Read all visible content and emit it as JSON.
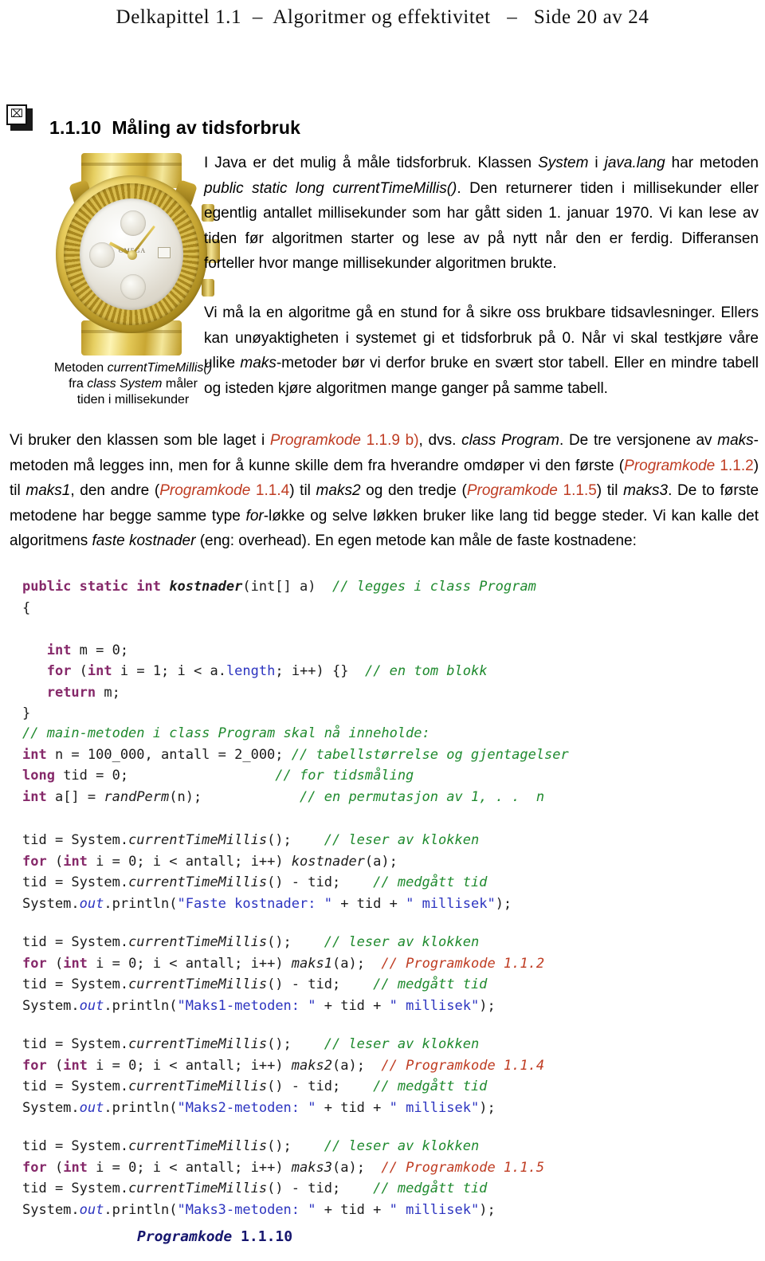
{
  "page_header": "Delkapittel 1.1  –  Algoritmer og effektivitet   –   Side 20 av 24",
  "section": {
    "heading": "1.1.10  Måling av tidsforbruk",
    "broken_image_glyph": "⌧"
  },
  "figure": {
    "alt": "gull-kronograf armbåndsur",
    "brand_text": "OMEGA",
    "caption_line1_plain": "Metoden ",
    "caption_line1_italic": "currentTimeMillis()",
    "caption_line2_plain": "fra ",
    "caption_line2_italic": "class System",
    "caption_line2_tail": " måler",
    "caption_line3": "tiden i millisekunder"
  },
  "paragraphs": {
    "p1": {
      "t1": "I Java er det mulig å måle tidsforbruk. Klassen ",
      "i1": "System",
      "t2": " i ",
      "i2": "java.lang",
      "t3": " har metoden ",
      "i3": "public static long currentTimeMillis()",
      "t4": ". Den returnerer tiden i millisekunder eller egentlig antallet millisekunder som har gått siden 1. januar 1970. Vi kan lese av tiden før algoritmen starter og lese av på nytt når den er ferdig. Differansen forteller hvor mange millisekunder algoritmen brukte."
    },
    "p2": {
      "t1": "Vi må la en algoritme gå en stund for å sikre oss brukbare tidsavlesninger. Ellers kan unøyaktigheten i systemet gi et tidsforbruk på 0. Når vi skal testkjøre våre ulike ",
      "i1": "maks",
      "t2": "-metoder bør vi derfor bruke en svært stor tabell. Eller en mindre tabell og isteden kjøre algoritmen mange ganger på samme tabell."
    },
    "p3": {
      "t1": "Vi bruker den klassen som ble laget i ",
      "l1": "Programkode ",
      "l1n": "1.1.9 b)",
      "t2": ", dvs. ",
      "i1": "class Program",
      "t3": ". De tre versjonene av ",
      "i2": "maks",
      "t4": "-metoden må legges inn, men for å kunne skille dem fra hverandre omdøper vi den første (",
      "l2": "Programkode ",
      "l2n": "1.1.2",
      "t5": ") til ",
      "i3": "maks1",
      "t6": ", den andre (",
      "l3": "Programkode ",
      "l3n": "1.1.4",
      "t7": ") til ",
      "i4": "maks2",
      "t8": " og den tredje (",
      "l4": "Programkode ",
      "l4n": "1.1.5",
      "t9": ") til ",
      "i5": "maks3",
      "t10": ". De to første metodene har begge samme type ",
      "i6": "for",
      "t11": "-løkke og selve løkken bruker like lang tid begge steder. Vi kan kalle det algoritmens ",
      "i7": "faste kostnader",
      "t12": " (eng: overhead). En egen metode kan måle de faste kostnadene:"
    }
  },
  "code": {
    "block1": {
      "l1_kw1": "public static int ",
      "l1_name": "kostnader",
      "l1_sig": "(int[] a)  ",
      "l1_cm": "// legges i class Program",
      "l2": "{",
      "l3_kw": "int",
      "l3_rest": " m = 0;",
      "l4_kw": "for",
      "l4_a": " (",
      "l4_kw2": "int",
      "l4_b": " i = 1; i < a.",
      "l4_fld": "length",
      "l4_c": "; i++) {}  ",
      "l4_cm": "// en tom blokk",
      "l5_kw": "return",
      "l5_rest": " m;",
      "l6": "}"
    },
    "block2": {
      "l1_cm": "// main-metoden i class Program skal nå inneholde:",
      "l2_kw": "int",
      "l2_mid": " n = 100_000, antall = 2_000; ",
      "l2_cm": "// tabellstørrelse og gjentagelser",
      "l3_kw": "long",
      "l3_mid": " tid = 0;                  ",
      "l3_cm": "// for tidsmåling",
      "l4_kw": "int",
      "l4_mid": " a[] = ",
      "l4_mth": "randPerm",
      "l4_mid2": "(n);            ",
      "l4_cm": "// en permutasjon av 1, . .  n"
    },
    "block3": {
      "l1_a": "tid = System.",
      "l1_m": "currentTimeMillis",
      "l1_b": "();    ",
      "l1_cm": "// leser av klokken",
      "l2_kw": "for",
      "l2_a": " (",
      "l2_kw2": "int",
      "l2_b": " i = 0; i < antall; i++) ",
      "l2_m": "kostnader",
      "l2_c": "(a);",
      "l3_a": "tid = System.",
      "l3_m": "currentTimeMillis",
      "l3_b": "() - tid;    ",
      "l3_cm": "// medgått tid",
      "l4_a": "System.",
      "l4_fld": "out",
      "l4_b": ".println(",
      "l4_st": "\"Faste kostnader: \"",
      "l4_c": " + tid + ",
      "l4_st2": "\" millisek\"",
      "l4_d": ");"
    },
    "block4": {
      "l1_a": "tid = System.",
      "l1_m": "currentTimeMillis",
      "l1_b": "();    ",
      "l1_cm": "// leser av klokken",
      "l2_kw": "for",
      "l2_a": " (",
      "l2_kw2": "int",
      "l2_b": " i = 0; i < antall; i++) ",
      "l2_m": "maks1",
      "l2_c": "(a);  ",
      "l2_cmr": "// Programkode 1.1.2",
      "l3_a": "tid = System.",
      "l3_m": "currentTimeMillis",
      "l3_b": "() - tid;    ",
      "l3_cm": "// medgått tid",
      "l4_a": "System.",
      "l4_fld": "out",
      "l4_b": ".println(",
      "l4_st": "\"Maks1-metoden: \"",
      "l4_c": " + tid + ",
      "l4_st2": "\" millisek\"",
      "l4_d": ");"
    },
    "block5": {
      "l1_a": "tid = System.",
      "l1_m": "currentTimeMillis",
      "l1_b": "();    ",
      "l1_cm": "// leser av klokken",
      "l2_kw": "for",
      "l2_a": " (",
      "l2_kw2": "int",
      "l2_b": " i = 0; i < antall; i++) ",
      "l2_m": "maks2",
      "l2_c": "(a);  ",
      "l2_cmr": "// Programkode 1.1.4",
      "l3_a": "tid = System.",
      "l3_m": "currentTimeMillis",
      "l3_b": "() - tid;    ",
      "l3_cm": "// medgått tid",
      "l4_a": "System.",
      "l4_fld": "out",
      "l4_b": ".println(",
      "l4_st": "\"Maks2-metoden: \"",
      "l4_c": " + tid + ",
      "l4_st2": "\" millisek\"",
      "l4_d": ");"
    },
    "block6": {
      "l1_a": "tid = System.",
      "l1_m": "currentTimeMillis",
      "l1_b": "();    ",
      "l1_cm": "// leser av klokken",
      "l2_kw": "for",
      "l2_a": " (",
      "l2_kw2": "int",
      "l2_b": " i = 0; i < antall; i++) ",
      "l2_m": "maks3",
      "l2_c": "(a);  ",
      "l2_cmr": "// Programkode 1.1.5",
      "l3_a": "tid = System.",
      "l3_m": "currentTimeMillis",
      "l3_b": "() - tid;    ",
      "l3_cm": "// medgått tid",
      "l4_a": "System.",
      "l4_fld": "out",
      "l4_b": ".println(",
      "l4_st": "\"Maks3-metoden: \"",
      "l4_c": " + tid + ",
      "l4_st2": "\" millisek\"",
      "l4_d": ");"
    },
    "footer_title": "Programkode",
    "footer_num": " 1.1.10"
  },
  "colors": {
    "link": "#bf3c22",
    "keyword": "#86296a",
    "comment": "#1f8a2e",
    "string": "#2c34c0",
    "footer": "#16166e",
    "text": "#000000"
  }
}
